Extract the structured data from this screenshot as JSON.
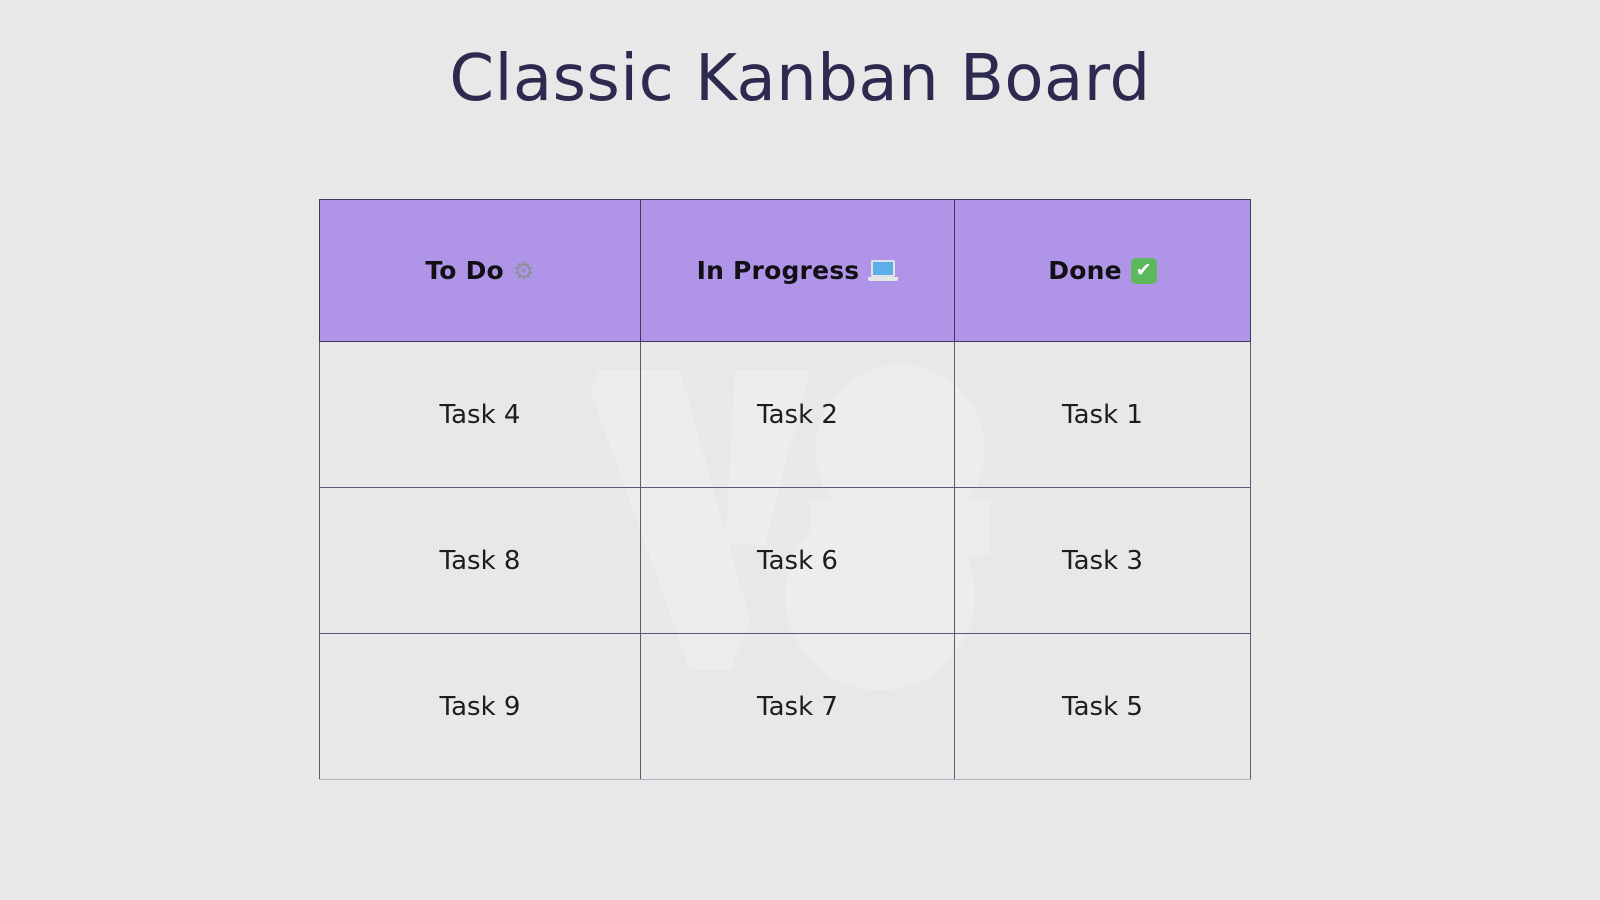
{
  "page": {
    "title": "Classic Kanban Board",
    "background_color": "#e9e8e8",
    "title_color": "#2d2a50"
  },
  "board": {
    "header_background": "#b094e8",
    "cell_background": "#e8e7e7",
    "border_color": "#3c3a55",
    "columns": [
      {
        "id": "todo",
        "label": "To Do",
        "icon": "gear-icon",
        "icon_glyph": "⚙",
        "cards": [
          "Task 4",
          "Task 8",
          "Task 9"
        ]
      },
      {
        "id": "in-progress",
        "label": "In Progress",
        "icon": "laptop-icon",
        "icon_glyph": "💻",
        "cards": [
          "Task 2",
          "Task 6",
          "Task 7"
        ]
      },
      {
        "id": "done",
        "label": "Done",
        "icon": "check-mark-button-icon",
        "icon_glyph": "✔",
        "cards": [
          "Task 1",
          "Task 3",
          "Task 5"
        ]
      }
    ]
  },
  "watermark": {
    "text": "VS",
    "visible": true
  }
}
